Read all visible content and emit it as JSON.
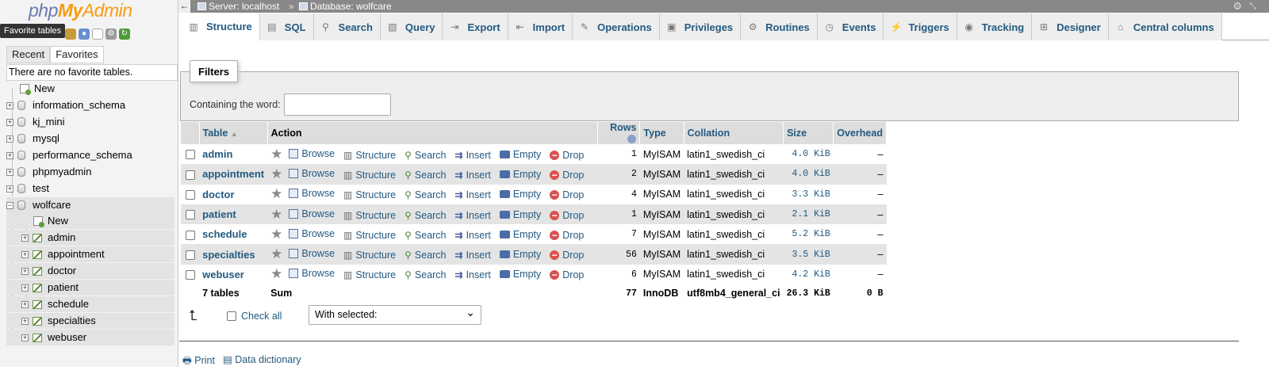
{
  "logo": {
    "php": "php",
    "my": "My",
    "admin": "Admin"
  },
  "tooltip": "Favorite tables",
  "nav": {
    "icons": [
      "home-icon",
      "logout-icon",
      "help-icon",
      "docs-icon",
      "settings-icon",
      "reload-icon"
    ],
    "tabs": {
      "recent": "Recent",
      "favorites": "Favorites"
    },
    "no_favorites": "There are no favorite tables.",
    "new_label": "New",
    "databases": [
      "information_schema",
      "kj_mini",
      "mysql",
      "performance_schema",
      "phpmyadmin",
      "test",
      "wolfcare"
    ],
    "expanded_db": "wolfcare",
    "db_new_label": "New",
    "db_tables": [
      "admin",
      "appointment",
      "doctor",
      "patient",
      "schedule",
      "specialties",
      "webuser"
    ]
  },
  "topbar": {
    "server": "Server: localhost",
    "separator": "»",
    "database": "Database: wolfcare"
  },
  "tabs": [
    {
      "label": "Structure",
      "icon": "structure-icon"
    },
    {
      "label": "SQL",
      "icon": "sql-icon"
    },
    {
      "label": "Search",
      "icon": "search-icon"
    },
    {
      "label": "Query",
      "icon": "query-icon"
    },
    {
      "label": "Export",
      "icon": "export-icon"
    },
    {
      "label": "Import",
      "icon": "import-icon"
    },
    {
      "label": "Operations",
      "icon": "operations-icon"
    },
    {
      "label": "Privileges",
      "icon": "privileges-icon"
    },
    {
      "label": "Routines",
      "icon": "routines-icon"
    },
    {
      "label": "Events",
      "icon": "events-icon"
    },
    {
      "label": "Triggers",
      "icon": "triggers-icon"
    },
    {
      "label": "Tracking",
      "icon": "tracking-icon"
    },
    {
      "label": "Designer",
      "icon": "designer-icon"
    },
    {
      "label": "Central columns",
      "icon": "central-columns-icon"
    }
  ],
  "filters": {
    "legend": "Filters",
    "label": "Containing the word:",
    "value": ""
  },
  "table": {
    "headers": {
      "table": "Table",
      "action": "Action",
      "rows": "Rows",
      "type": "Type",
      "collation": "Collation",
      "size": "Size",
      "overhead": "Overhead"
    },
    "actions": [
      "Browse",
      "Structure",
      "Search",
      "Insert",
      "Empty",
      "Drop"
    ],
    "rows": [
      {
        "name": "admin",
        "rows": "1",
        "type": "MyISAM",
        "collation": "latin1_swedish_ci",
        "size": "4.0 KiB",
        "overhead": "–"
      },
      {
        "name": "appointment",
        "rows": "2",
        "type": "MyISAM",
        "collation": "latin1_swedish_ci",
        "size": "4.0 KiB",
        "overhead": "–"
      },
      {
        "name": "doctor",
        "rows": "4",
        "type": "MyISAM",
        "collation": "latin1_swedish_ci",
        "size": "3.3 KiB",
        "overhead": "–"
      },
      {
        "name": "patient",
        "rows": "1",
        "type": "MyISAM",
        "collation": "latin1_swedish_ci",
        "size": "2.1 KiB",
        "overhead": "–"
      },
      {
        "name": "schedule",
        "rows": "7",
        "type": "MyISAM",
        "collation": "latin1_swedish_ci",
        "size": "5.2 KiB",
        "overhead": "–"
      },
      {
        "name": "specialties",
        "rows": "56",
        "type": "MyISAM",
        "collation": "latin1_swedish_ci",
        "size": "3.5 KiB",
        "overhead": "–"
      },
      {
        "name": "webuser",
        "rows": "6",
        "type": "MyISAM",
        "collation": "latin1_swedish_ci",
        "size": "4.2 KiB",
        "overhead": "–"
      }
    ],
    "footer": {
      "count": "7 tables",
      "sum": "Sum",
      "rows": "77",
      "type": "InnoDB",
      "collation": "utf8mb4_general_ci",
      "size": "26.3 KiB",
      "overhead": "0 B"
    }
  },
  "bulk": {
    "check_all": "Check all",
    "with_selected": "With selected:"
  },
  "bottom_links": {
    "print": "Print",
    "data_dictionary": "Data dictionary"
  }
}
